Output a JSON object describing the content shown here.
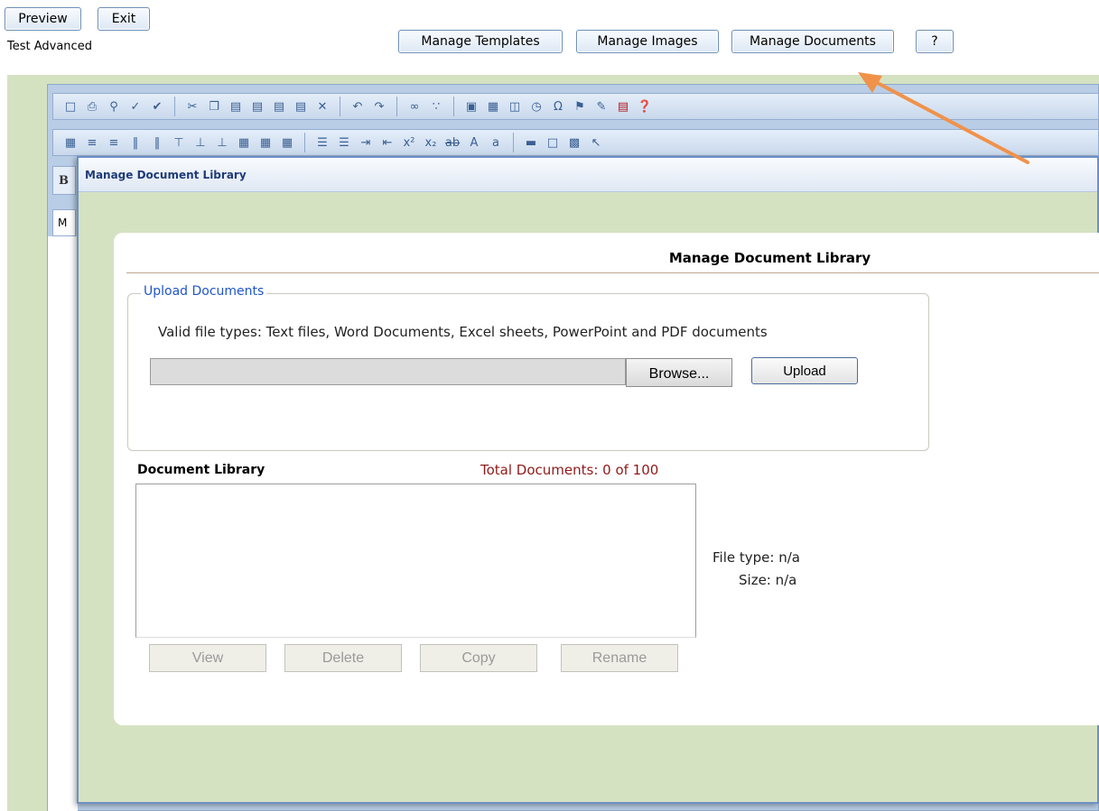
{
  "header": {
    "preview_label": "Preview",
    "exit_label": "Exit",
    "title": "Test Advanced",
    "manage_templates_label": "Manage Templates",
    "manage_images_label": "Manage Images",
    "manage_documents_label": "Manage Documents",
    "help_label": "?"
  },
  "toolbar": {
    "row1_icons": [
      "new-document-icon",
      "print-icon",
      "find-icon",
      "check-icon",
      "spellcheck-icon",
      "cut-icon",
      "copy-icon",
      "paste-icon",
      "paste-text-icon",
      "paste-word-icon",
      "paste-html-icon",
      "delete-icon",
      "undo-icon",
      "redo-icon",
      "link-icon",
      "unlink-icon",
      "image-icon",
      "table-icon",
      "form-icon",
      "time-icon",
      "special-char-icon",
      "flash-icon",
      "edit-icon",
      "pdf-icon",
      "help-icon"
    ],
    "row2_icons": [
      "insert-table-icon",
      "insert-row-icon",
      "insert-column-icon",
      "merge-cells-icon",
      "split-cells-icon",
      "list-ordered-icon",
      "list-unordered-icon",
      "indent-icon",
      "outdent-icon",
      "superscript-icon",
      "subscript-icon",
      "strikethrough-icon",
      "font-size-up-icon",
      "font-size-down-icon",
      "horizontal-rule-icon",
      "absolute-position-icon",
      "grid-icon",
      "select-icon"
    ],
    "stub_bold": "B",
    "stub_m": "M"
  },
  "modal": {
    "title": "Manage Document Library",
    "header": "Manage Document Library",
    "upload": {
      "legend": "Upload Documents",
      "valid_types": "Valid file types: Text files, Word Documents, Excel sheets, PowerPoint and PDF documents",
      "file_path": "",
      "browse_label": "Browse...",
      "upload_label": "Upload"
    },
    "library": {
      "label": "Document Library",
      "total": "Total Documents: 0 of 100",
      "items": [],
      "view_label": "View",
      "delete_label": "Delete",
      "copy_label": "Copy",
      "rename_label": "Rename",
      "file_type": "File type: n/a",
      "file_size": "Size: n/a"
    }
  },
  "colors": {
    "accent_arrow": "#f0924a",
    "modal_border": "#6d91c6",
    "title_blue": "#1f3b78",
    "legend_blue": "#1f56c9",
    "total_red": "#8f1a1a",
    "green_band": "#d5e2c2"
  }
}
